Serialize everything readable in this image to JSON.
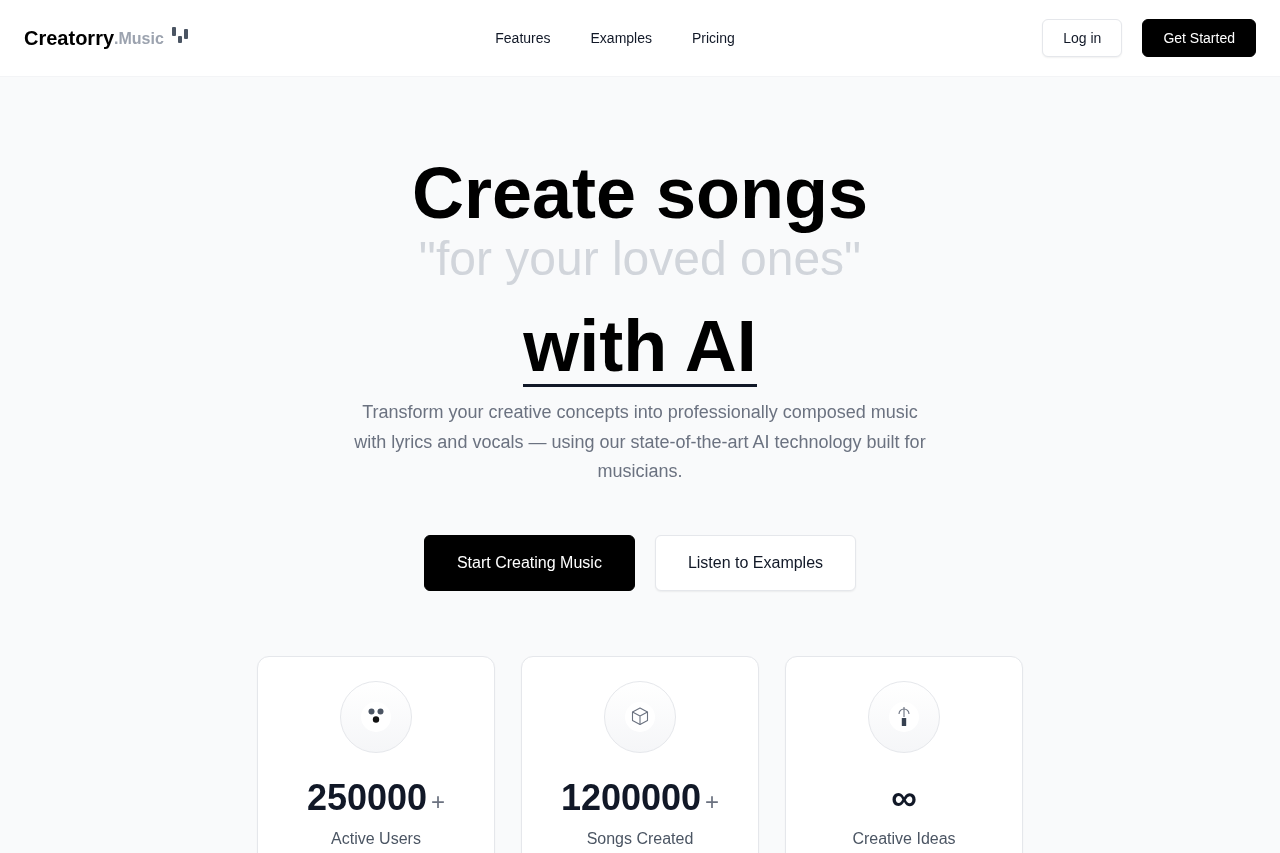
{
  "header": {
    "logo": {
      "name": "Creatorry",
      "suffix": ".Music"
    },
    "nav": [
      {
        "label": "Features"
      },
      {
        "label": "Examples"
      },
      {
        "label": "Pricing"
      }
    ],
    "actions": [
      {
        "label": "Log in",
        "kind": "secondary"
      },
      {
        "label": "Get Started",
        "kind": "primary"
      }
    ]
  },
  "hero": {
    "title": "Create songs",
    "phrase": "\"for your loved ones\"",
    "title_accent": "with AI",
    "description": "Transform your creative concepts into professionally composed music with lyrics and vocals — using our state-of-the-art AI technology built for musicians.",
    "buttons": [
      {
        "label": "Start Creating Music",
        "kind": "primary"
      },
      {
        "label": "Listen to Examples",
        "kind": "secondary"
      }
    ]
  },
  "stats": [
    {
      "value": "250000",
      "suffix": "+",
      "label": "Active Users"
    },
    {
      "value": "1200000",
      "suffix": "+",
      "label": "Songs Created"
    },
    {
      "value": "∞",
      "label": "Creative Ideas"
    }
  ]
}
